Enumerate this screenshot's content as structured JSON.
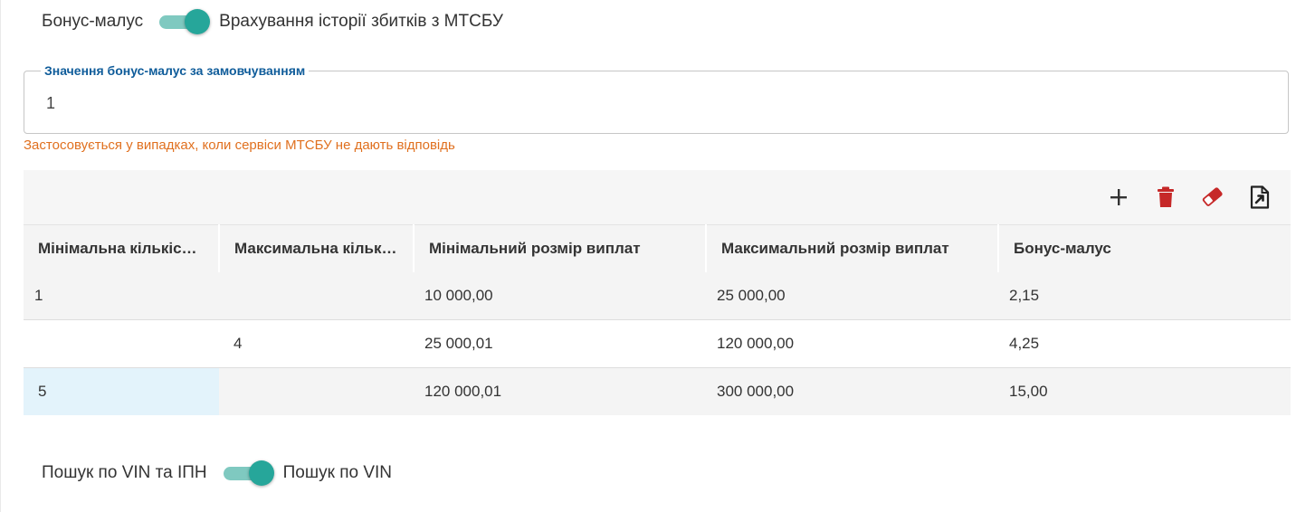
{
  "bonus_toggle": {
    "left_label": "Бонус-малус",
    "right_label": "Врахування історії збитків з МТСБУ",
    "checked": true
  },
  "default_field": {
    "legend": "Значення бонус-малус за замовчуванням",
    "value": "1",
    "helper": "Застосовується у випадках, коли сервіси МТСБУ не дають відповідь"
  },
  "toolbar": {
    "icons": [
      "plus-icon",
      "trash-icon",
      "eraser-icon",
      "export-icon"
    ],
    "colors": {
      "plus": "#333333",
      "trash": "#c62828",
      "eraser": "#c62828",
      "export": "#222222"
    }
  },
  "table": {
    "columns": [
      "Мінімальна кількіс…",
      "Максимальна кільк…",
      "Мінімальний розмір виплат",
      "Максимальний розмір виплат",
      "Бонус-малус"
    ],
    "rows": [
      [
        "1",
        "",
        "10 000,00",
        "25 000,00",
        "2,15"
      ],
      [
        "",
        "4",
        "25 000,01",
        "120 000,00",
        "4,25"
      ],
      [
        "5",
        "",
        "120 000,01",
        "300 000,00",
        "15,00"
      ]
    ]
  },
  "vin_toggle": {
    "left_label": "Пошук по VIN та ІПН",
    "right_label": "Пошук по VIN",
    "checked": true
  },
  "accent_color": "#26a69a"
}
